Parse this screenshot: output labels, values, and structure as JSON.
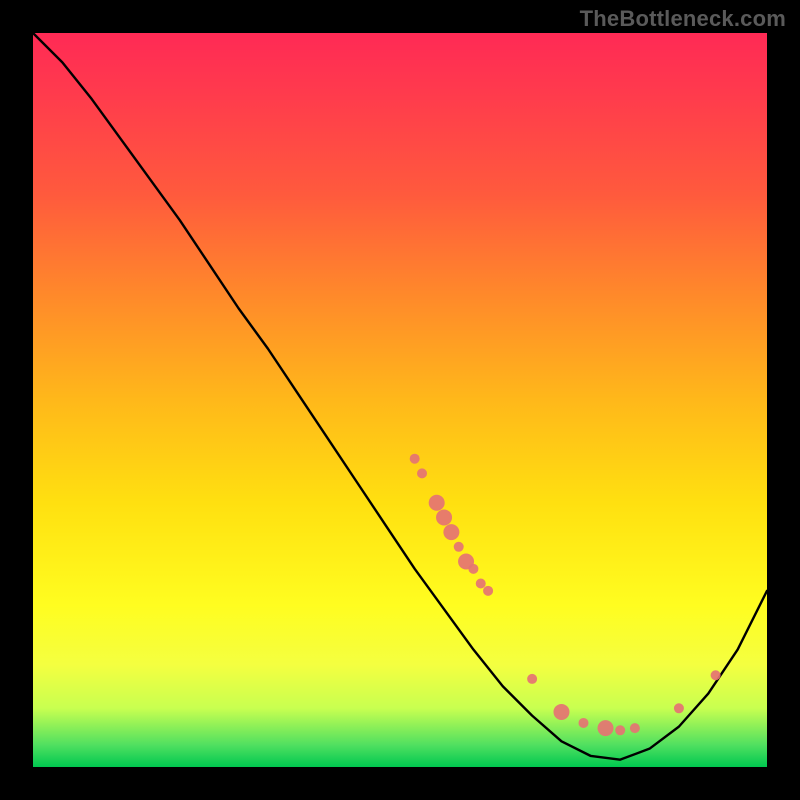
{
  "branding": {
    "text": "TheBottleneck.com"
  },
  "chart_data": {
    "type": "line",
    "title": "",
    "xlabel": "",
    "ylabel": "",
    "xlim": [
      0,
      100
    ],
    "ylim": [
      0,
      100
    ],
    "grid": false,
    "series": [
      {
        "name": "curve",
        "color": "#000000",
        "x": [
          0,
          4,
          8,
          12,
          16,
          20,
          24,
          28,
          32,
          36,
          40,
          44,
          48,
          52,
          56,
          60,
          64,
          68,
          72,
          76,
          80,
          84,
          88,
          92,
          96,
          100
        ],
        "y": [
          100,
          96,
          91,
          85.5,
          80,
          74.5,
          68.5,
          62.5,
          57,
          51,
          45,
          39,
          33,
          27,
          21.5,
          16,
          11,
          7,
          3.5,
          1.5,
          1,
          2.5,
          5.5,
          10,
          16,
          24
        ]
      }
    ],
    "markers": {
      "name": "dots",
      "color": "#e57373",
      "radius_small": 5,
      "radius_large": 8,
      "points": [
        {
          "x": 52,
          "y": 42,
          "r": "small"
        },
        {
          "x": 53,
          "y": 40,
          "r": "small"
        },
        {
          "x": 55,
          "y": 36,
          "r": "large"
        },
        {
          "x": 56,
          "y": 34,
          "r": "large"
        },
        {
          "x": 57,
          "y": 32,
          "r": "large"
        },
        {
          "x": 58,
          "y": 30,
          "r": "small"
        },
        {
          "x": 59,
          "y": 28,
          "r": "large"
        },
        {
          "x": 60,
          "y": 27,
          "r": "small"
        },
        {
          "x": 61,
          "y": 25,
          "r": "small"
        },
        {
          "x": 62,
          "y": 24,
          "r": "small"
        },
        {
          "x": 68,
          "y": 12,
          "r": "small"
        },
        {
          "x": 72,
          "y": 7.5,
          "r": "large"
        },
        {
          "x": 75,
          "y": 6,
          "r": "small"
        },
        {
          "x": 78,
          "y": 5.3,
          "r": "large"
        },
        {
          "x": 80,
          "y": 5,
          "r": "small"
        },
        {
          "x": 82,
          "y": 5.3,
          "r": "small"
        },
        {
          "x": 88,
          "y": 8,
          "r": "small"
        },
        {
          "x": 93,
          "y": 12.5,
          "r": "small"
        }
      ]
    }
  }
}
